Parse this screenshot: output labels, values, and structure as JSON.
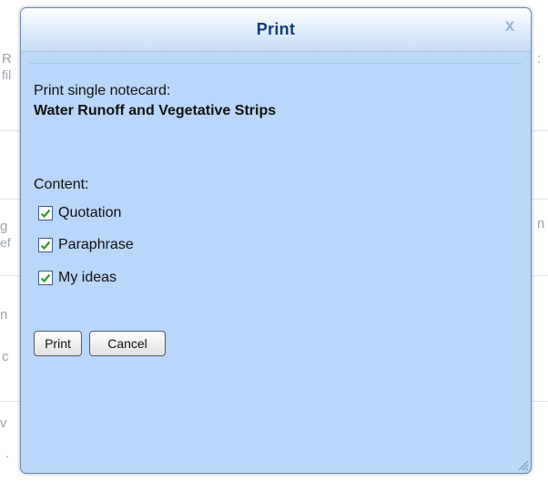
{
  "background_page": {
    "left_fragments": [
      "R",
      "fil",
      "g",
      "ef",
      "n",
      "c",
      "v",
      "."
    ],
    "right_fragments": [
      ":",
      "n"
    ]
  },
  "dialog": {
    "title": "Print",
    "close_glyph": "x",
    "heading": "Print single notecard:",
    "notecard_title": "Water Runoff and Vegetative Strips",
    "content_label": "Content:",
    "options": [
      {
        "label": "Quotation",
        "checked": true
      },
      {
        "label": "Paraphrase",
        "checked": true
      },
      {
        "label": "My ideas",
        "checked": true
      }
    ],
    "buttons": {
      "print": "Print",
      "cancel": "Cancel"
    }
  },
  "colors": {
    "dialog_bg": "#bdd8f8",
    "title_text": "#123d7a",
    "checkmark": "#2f9a2f"
  }
}
